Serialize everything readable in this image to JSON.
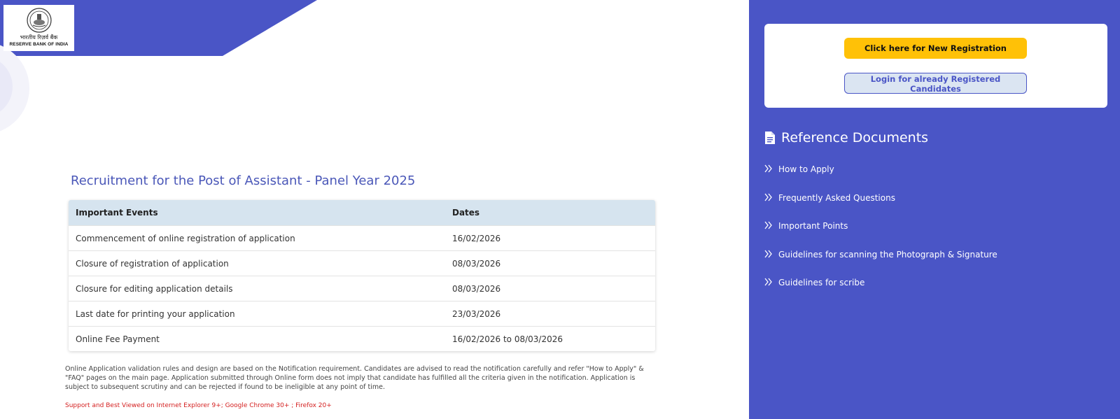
{
  "header": {
    "logo_hindi": "भारतीय रिज़र्व बैंक",
    "logo_english": "RESERVE BANK OF INDIA"
  },
  "main": {
    "title": "Recruitment for the Post of Assistant - Panel Year 2025",
    "table": {
      "headers": [
        "Important Events",
        "Dates"
      ],
      "rows": [
        {
          "event": "Commencement of online registration of application",
          "date": "16/02/2026"
        },
        {
          "event": "Closure of registration of application",
          "date": "08/03/2026"
        },
        {
          "event": "Closure for editing application details",
          "date": "08/03/2026"
        },
        {
          "event": "Last date for printing your application",
          "date": "23/03/2026"
        },
        {
          "event": "Online Fee Payment",
          "date": "16/02/2026 to 08/03/2026"
        }
      ]
    },
    "notice": "Online Application validation rules and design are based on the Notification requirement. Candidates are advised to read the notification carefully and refer \"How to Apply\" & \"FAQ\" pages on the main page. Application submitted through Online form does not imply that candidate has fulfilled all the criteria given in the notification. Application is subject to subsequent scrutiny and can be rejected if found to be ineligible at any point of time.",
    "browser_support": "Support and Best Viewed on Internet Explorer 9+; Google Chrome 30+ ; Firefox 20+"
  },
  "sidebar": {
    "new_registration_label": "Click here for New Registration",
    "login_label": "Login for already Registered Candidates",
    "reference_heading": "Reference Documents",
    "reference_items": [
      {
        "label": "How to Apply"
      },
      {
        "label": "Frequently Asked Questions"
      },
      {
        "label": "Important Points"
      },
      {
        "label": "Guidelines for scanning the Photograph & Signature"
      },
      {
        "label": "Guidelines for scribe"
      }
    ]
  },
  "colors": {
    "brand": "#4a55c6",
    "accent": "#ffc107",
    "table_header": "#d6e4ef",
    "title": "#4a57b8",
    "warning_text": "#d42020"
  },
  "icons": {
    "reference_heading": "document-icon",
    "reference_item": "double-chevron-right-icon",
    "logo": "rbi-emblem-icon"
  }
}
